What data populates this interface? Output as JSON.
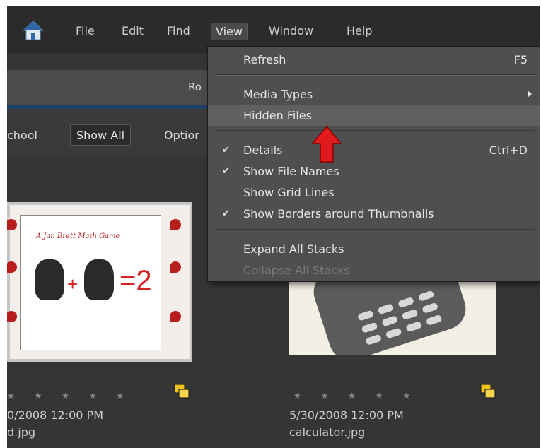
{
  "menubar": {
    "items": [
      "File",
      "Edit",
      "Find",
      "View",
      "Window",
      "Help"
    ]
  },
  "toolbar": {
    "partial_label": "Ro"
  },
  "filter": {
    "left_text": "chool",
    "show_all": "Show All",
    "options": "Optior"
  },
  "view_menu": {
    "refresh": {
      "label": "Refresh",
      "shortcut": "F5"
    },
    "media_types": {
      "label": "Media Types"
    },
    "hidden_files": {
      "label": "Hidden Files"
    },
    "details": {
      "label": "Details",
      "shortcut": "Ctrl+D",
      "checked": true
    },
    "show_file_names": {
      "label": "Show File Names",
      "checked": true
    },
    "show_grid_lines": {
      "label": "Show Grid Lines",
      "checked": false
    },
    "show_borders": {
      "label": "Show Borders around Thumbnails",
      "checked": true
    },
    "expand_stacks": {
      "label": "Expand All Stacks"
    },
    "collapse_stacks": {
      "label": "Collapse All Stacks"
    }
  },
  "thumbnails": [
    {
      "title": "A Jan Brett Math Game",
      "equation": "=2",
      "plus": "+",
      "date": "0/2008 12:00 PM",
      "filename": "d.jpg"
    },
    {
      "date": "5/30/2008 12:00 PM",
      "filename": "calculator.jpg"
    }
  ],
  "check_glyph": "✔",
  "star_glyph": "★ ★ ★ ★ ★",
  "colors": {
    "menu_bg": "#4f4f4f",
    "highlight": "#606060",
    "arrow_red": "#e11b1b"
  },
  "icons": [
    "home-icon",
    "submenu-arrow-icon",
    "checkmark-icon",
    "stack-icon",
    "red-arrow-icon"
  ]
}
